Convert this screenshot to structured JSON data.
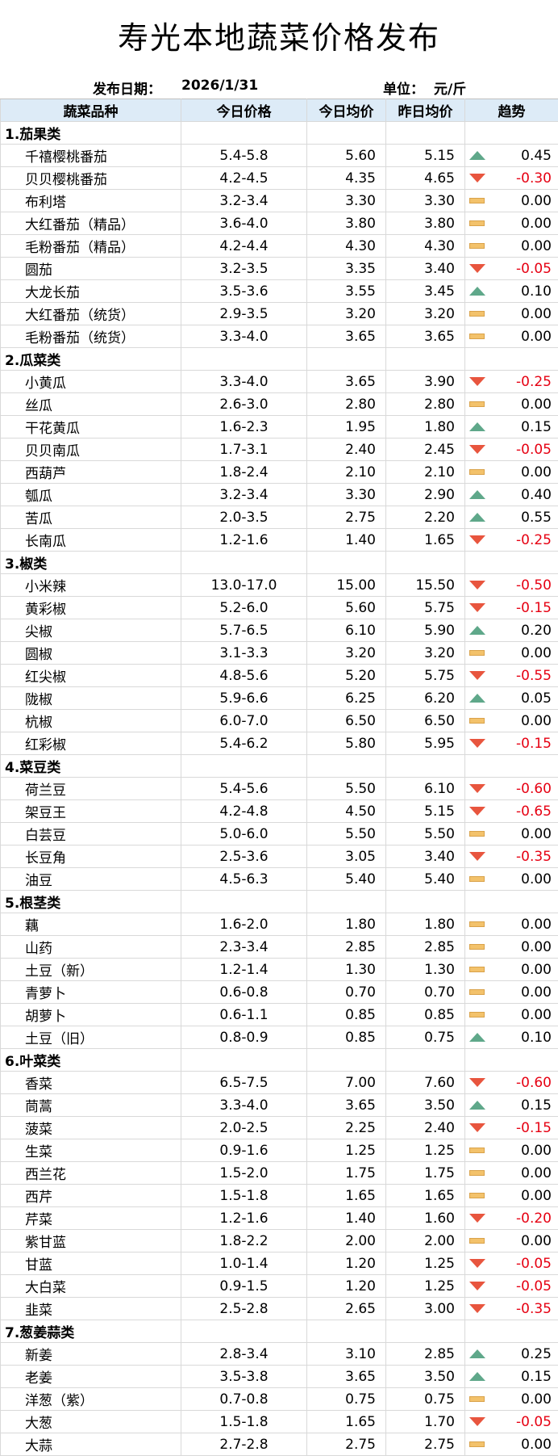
{
  "title": "寿光本地蔬菜价格发布",
  "meta": {
    "date_label": "发布日期：",
    "date_value": "2026/1/31",
    "unit_label": "单位：",
    "unit_value": "元/斤"
  },
  "headers": [
    "蔬菜品种",
    "今日价格",
    "今日均价",
    "昨日均价",
    "趋势"
  ],
  "colors": {
    "up": "#5fa88a",
    "down": "#e8553e",
    "flat": "#f3c26b",
    "negative": "#e60012",
    "header_bg": "#ddebf7"
  },
  "categories": [
    {
      "name": "1.茄果类",
      "items": [
        {
          "name": "千禧樱桃番茄",
          "range": "5.4-5.8",
          "today": "5.60",
          "yesterday": "5.15",
          "trend": "up",
          "change": "0.45"
        },
        {
          "name": "贝贝樱桃番茄",
          "range": "4.2-4.5",
          "today": "4.35",
          "yesterday": "4.65",
          "trend": "down",
          "change": "-0.30"
        },
        {
          "name": "布利塔",
          "range": "3.2-3.4",
          "today": "3.30",
          "yesterday": "3.30",
          "trend": "flat",
          "change": "0.00"
        },
        {
          "name": "大红番茄（精品）",
          "range": "3.6-4.0",
          "today": "3.80",
          "yesterday": "3.80",
          "trend": "flat",
          "change": "0.00"
        },
        {
          "name": "毛粉番茄（精品）",
          "range": "4.2-4.4",
          "today": "4.30",
          "yesterday": "4.30",
          "trend": "flat",
          "change": "0.00"
        },
        {
          "name": "圆茄",
          "range": "3.2-3.5",
          "today": "3.35",
          "yesterday": "3.40",
          "trend": "down",
          "change": "-0.05"
        },
        {
          "name": "大龙长茄",
          "range": "3.5-3.6",
          "today": "3.55",
          "yesterday": "3.45",
          "trend": "up",
          "change": "0.10"
        },
        {
          "name": "大红番茄（统货）",
          "range": "2.9-3.5",
          "today": "3.20",
          "yesterday": "3.20",
          "trend": "flat",
          "change": "0.00"
        },
        {
          "name": "毛粉番茄（统货）",
          "range": "3.3-4.0",
          "today": "3.65",
          "yesterday": "3.65",
          "trend": "flat",
          "change": "0.00"
        }
      ]
    },
    {
      "name": "2.瓜菜类",
      "items": [
        {
          "name": "小黄瓜",
          "range": "3.3-4.0",
          "today": "3.65",
          "yesterday": "3.90",
          "trend": "down",
          "change": "-0.25"
        },
        {
          "name": "丝瓜",
          "range": "2.6-3.0",
          "today": "2.80",
          "yesterday": "2.80",
          "trend": "flat",
          "change": "0.00"
        },
        {
          "name": "干花黄瓜",
          "range": "1.6-2.3",
          "today": "1.95",
          "yesterday": "1.80",
          "trend": "up",
          "change": "0.15"
        },
        {
          "name": "贝贝南瓜",
          "range": "1.7-3.1",
          "today": "2.40",
          "yesterday": "2.45",
          "trend": "down",
          "change": "-0.05"
        },
        {
          "name": "西葫芦",
          "range": "1.8-2.4",
          "today": "2.10",
          "yesterday": "2.10",
          "trend": "flat",
          "change": "0.00"
        },
        {
          "name": "瓠瓜",
          "range": "3.2-3.4",
          "today": "3.30",
          "yesterday": "2.90",
          "trend": "up",
          "change": "0.40"
        },
        {
          "name": "苦瓜",
          "range": "2.0-3.5",
          "today": "2.75",
          "yesterday": "2.20",
          "trend": "up",
          "change": "0.55"
        },
        {
          "name": "长南瓜",
          "range": "1.2-1.6",
          "today": "1.40",
          "yesterday": "1.65",
          "trend": "down",
          "change": "-0.25"
        }
      ]
    },
    {
      "name": "3.椒类",
      "items": [
        {
          "name": "小米辣",
          "range": "13.0-17.0",
          "today": "15.00",
          "yesterday": "15.50",
          "trend": "down",
          "change": "-0.50"
        },
        {
          "name": "黄彩椒",
          "range": "5.2-6.0",
          "today": "5.60",
          "yesterday": "5.75",
          "trend": "down",
          "change": "-0.15"
        },
        {
          "name": "尖椒",
          "range": "5.7-6.5",
          "today": "6.10",
          "yesterday": "5.90",
          "trend": "up",
          "change": "0.20"
        },
        {
          "name": "圆椒",
          "range": "3.1-3.3",
          "today": "3.20",
          "yesterday": "3.20",
          "trend": "flat",
          "change": "0.00"
        },
        {
          "name": "红尖椒",
          "range": "4.8-5.6",
          "today": "5.20",
          "yesterday": "5.75",
          "trend": "down",
          "change": "-0.55"
        },
        {
          "name": "陇椒",
          "range": "5.9-6.6",
          "today": "6.25",
          "yesterday": "6.20",
          "trend": "up",
          "change": "0.05"
        },
        {
          "name": "杭椒",
          "range": "6.0-7.0",
          "today": "6.50",
          "yesterday": "6.50",
          "trend": "flat",
          "change": "0.00"
        },
        {
          "name": "红彩椒",
          "range": "5.4-6.2",
          "today": "5.80",
          "yesterday": "5.95",
          "trend": "down",
          "change": "-0.15"
        }
      ]
    },
    {
      "name": "4.菜豆类",
      "items": [
        {
          "name": "荷兰豆",
          "range": "5.4-5.6",
          "today": "5.50",
          "yesterday": "6.10",
          "trend": "down",
          "change": "-0.60"
        },
        {
          "name": "架豆王",
          "range": "4.2-4.8",
          "today": "4.50",
          "yesterday": "5.15",
          "trend": "down",
          "change": "-0.65"
        },
        {
          "name": "白芸豆",
          "range": "5.0-6.0",
          "today": "5.50",
          "yesterday": "5.50",
          "trend": "flat",
          "change": "0.00"
        },
        {
          "name": "长豆角",
          "range": "2.5-3.6",
          "today": "3.05",
          "yesterday": "3.40",
          "trend": "down",
          "change": "-0.35"
        },
        {
          "name": "油豆",
          "range": "4.5-6.3",
          "today": "5.40",
          "yesterday": "5.40",
          "trend": "flat",
          "change": "0.00"
        }
      ]
    },
    {
      "name": "5.根茎类",
      "items": [
        {
          "name": "藕",
          "range": "1.6-2.0",
          "today": "1.80",
          "yesterday": "1.80",
          "trend": "flat",
          "change": "0.00"
        },
        {
          "name": "山药",
          "range": "2.3-3.4",
          "today": "2.85",
          "yesterday": "2.85",
          "trend": "flat",
          "change": "0.00"
        },
        {
          "name": "土豆（新）",
          "range": "1.2-1.4",
          "today": "1.30",
          "yesterday": "1.30",
          "trend": "flat",
          "change": "0.00"
        },
        {
          "name": "青萝卜",
          "range": "0.6-0.8",
          "today": "0.70",
          "yesterday": "0.70",
          "trend": "flat",
          "change": "0.00"
        },
        {
          "name": "胡萝卜",
          "range": "0.6-1.1",
          "today": "0.85",
          "yesterday": "0.85",
          "trend": "flat",
          "change": "0.00"
        },
        {
          "name": "土豆（旧）",
          "range": "0.8-0.9",
          "today": "0.85",
          "yesterday": "0.75",
          "trend": "up",
          "change": "0.10"
        }
      ]
    },
    {
      "name": "6.叶菜类",
      "items": [
        {
          "name": "香菜",
          "range": "6.5-7.5",
          "today": "7.00",
          "yesterday": "7.60",
          "trend": "down",
          "change": "-0.60"
        },
        {
          "name": "茼蒿",
          "range": "3.3-4.0",
          "today": "3.65",
          "yesterday": "3.50",
          "trend": "up",
          "change": "0.15"
        },
        {
          "name": "菠菜",
          "range": "2.0-2.5",
          "today": "2.25",
          "yesterday": "2.40",
          "trend": "down",
          "change": "-0.15"
        },
        {
          "name": "生菜",
          "range": "0.9-1.6",
          "today": "1.25",
          "yesterday": "1.25",
          "trend": "flat",
          "change": "0.00"
        },
        {
          "name": "西兰花",
          "range": "1.5-2.0",
          "today": "1.75",
          "yesterday": "1.75",
          "trend": "flat",
          "change": "0.00"
        },
        {
          "name": "西芹",
          "range": "1.5-1.8",
          "today": "1.65",
          "yesterday": "1.65",
          "trend": "flat",
          "change": "0.00"
        },
        {
          "name": "芹菜",
          "range": "1.2-1.6",
          "today": "1.40",
          "yesterday": "1.60",
          "trend": "down",
          "change": "-0.20"
        },
        {
          "name": "紫甘蓝",
          "range": "1.8-2.2",
          "today": "2.00",
          "yesterday": "2.00",
          "trend": "flat",
          "change": "0.00"
        },
        {
          "name": "甘蓝",
          "range": "1.0-1.4",
          "today": "1.20",
          "yesterday": "1.25",
          "trend": "down",
          "change": "-0.05"
        },
        {
          "name": "大白菜",
          "range": "0.9-1.5",
          "today": "1.20",
          "yesterday": "1.25",
          "trend": "down",
          "change": "-0.05"
        },
        {
          "name": "韭菜",
          "range": "2.5-2.8",
          "today": "2.65",
          "yesterday": "3.00",
          "trend": "down",
          "change": "-0.35"
        }
      ]
    },
    {
      "name": "7.葱姜蒜类",
      "items": [
        {
          "name": "新姜",
          "range": "2.8-3.4",
          "today": "3.10",
          "yesterday": "2.85",
          "trend": "up",
          "change": "0.25"
        },
        {
          "name": "老姜",
          "range": "3.5-3.8",
          "today": "3.65",
          "yesterday": "3.50",
          "trend": "up",
          "change": "0.15"
        },
        {
          "name": "洋葱（紫）",
          "range": "0.7-0.8",
          "today": "0.75",
          "yesterday": "0.75",
          "trend": "flat",
          "change": "0.00"
        },
        {
          "name": "大葱",
          "range": "1.5-1.8",
          "today": "1.65",
          "yesterday": "1.70",
          "trend": "down",
          "change": "-0.05"
        },
        {
          "name": "大蒜",
          "range": "2.7-2.8",
          "today": "2.75",
          "yesterday": "2.75",
          "trend": "flat",
          "change": "0.00"
        }
      ]
    }
  ]
}
